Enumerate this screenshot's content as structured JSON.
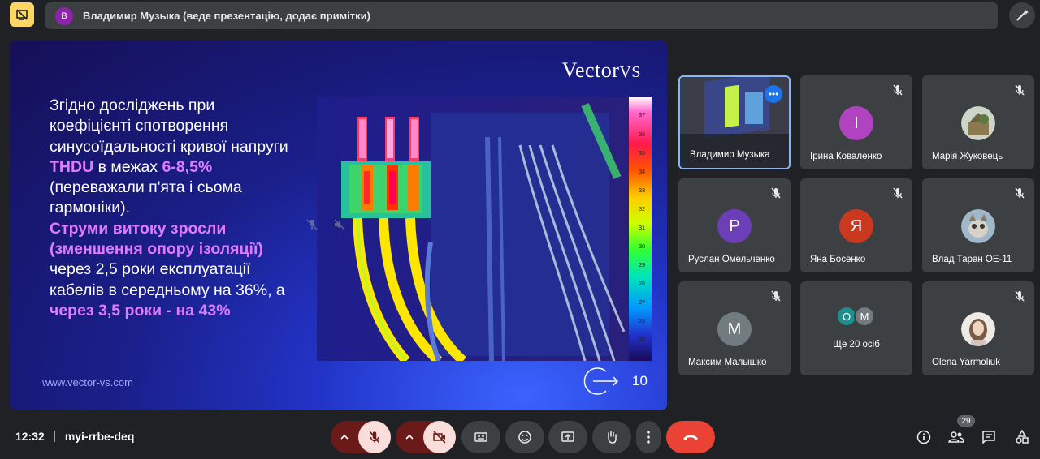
{
  "top_bar": {
    "presenter_initial": "В",
    "presenter_text": "Владимир Музыка (веде презентацію, додає примітки)"
  },
  "slide": {
    "logo_main": "Vector",
    "logo_suffix": "VS",
    "text_1": "Згідно досліджень при коефіцієнті спотворення синусоїдальності кривої напруги ",
    "text_hl_1": "THDU",
    "text_2": " в межах ",
    "text_hl_2": "6-8,5%",
    "text_3": " (переважали п'ята і сьома гармоніки). ",
    "text_hl_3": "Струми витоку зросли (зменшення опору ізоляції)",
    "text_4": " через 2,5 роки експлуатації кабелів в середньому на 36%, а ",
    "text_hl_4": "через 3,5 роки - на 43%",
    "url": "www.vector-vs.com",
    "page_number": "10",
    "scale_ticks": [
      "37",
      "36",
      "35",
      "34",
      "33",
      "32",
      "31",
      "30",
      "29",
      "28",
      "27",
      "26",
      "25"
    ]
  },
  "participants": [
    {
      "name": "Владимир Музыка",
      "initial": "",
      "color": "",
      "kind": "video"
    },
    {
      "name": "Ірина Коваленко",
      "initial": "І",
      "color": "#b142c0",
      "kind": "letter"
    },
    {
      "name": "Марія Жуковець",
      "initial": "",
      "color": "#8a9b6e",
      "kind": "photo"
    },
    {
      "name": "Руслан Омельченко",
      "initial": "Р",
      "color": "#6b3fb8",
      "kind": "letter"
    },
    {
      "name": "Яна Босенко",
      "initial": "Я",
      "color": "#c9381f",
      "kind": "letter"
    },
    {
      "name": "Влад Таран ОЕ-11",
      "initial": "",
      "color": "#9fb7c8",
      "kind": "photo"
    },
    {
      "name": "Максим Малышко",
      "initial": "М",
      "color": "#717b80",
      "kind": "letter"
    },
    {
      "name": "Ще 20 осіб",
      "initial": "",
      "color": "",
      "kind": "group",
      "mini": [
        "О",
        "М"
      ]
    },
    {
      "name": "Olena Yarmoliuk",
      "initial": "",
      "color": "#d9b8a5",
      "kind": "photo"
    }
  ],
  "bottom": {
    "time": "12:32",
    "meeting_code": "myi-rrbe-deq",
    "people_count": "29"
  },
  "colors": {
    "end_call": "#ea4335",
    "muted_bg": "#f9dedc",
    "muted_dark": "#6b1a1a"
  }
}
